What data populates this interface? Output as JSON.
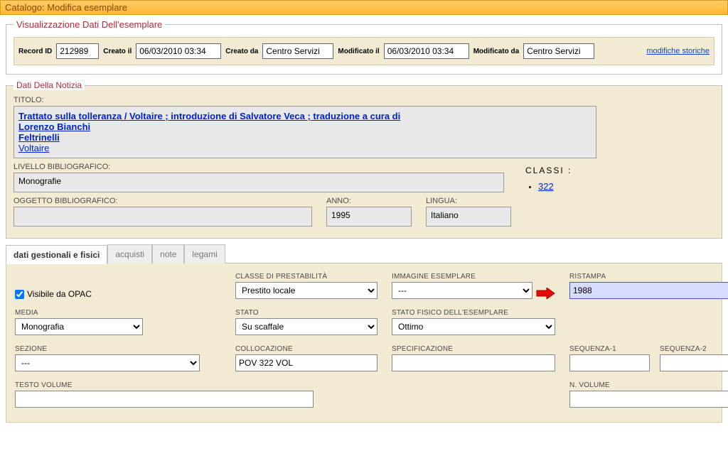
{
  "title": "Catalogo: Modifica esemplare",
  "sections": {
    "main_legend": "Visualizzazione Dati Dell'esemplare",
    "notizia_legend": "Dati Della Notizia"
  },
  "meta": {
    "record_id_label": "Record ID",
    "record_id": "212989",
    "created_label": "Creato il",
    "created": "06/03/2010 03:34",
    "created_by_label": "Creato da",
    "created_by": "Centro Servizi",
    "modified_label": "Modificato il",
    "modified": "06/03/2010 03:34",
    "modified_by_label": "Modificato da",
    "modified_by": "Centro Servizi",
    "hist_link": "modifiche storiche"
  },
  "notizia": {
    "titolo_label": "TITOLO:",
    "titolo_line1": "Trattato sulla tolleranza / Voltaire ; introduzione di Salvatore Veca ; traduzione a cura di",
    "titolo_line2": "Lorenzo Bianchi",
    "publisher": "Feltrinelli",
    "author": "Voltaire",
    "livello_label": "LIVELLO BIBLIOGRAFICO:",
    "livello": "Monografie",
    "oggetto_label": "OGGETTO BIBLIOGRAFICO:",
    "oggetto": "",
    "anno_label": "ANNO:",
    "anno": "1995",
    "lingua_label": "LINGUA:",
    "lingua": "Italiano",
    "classi_label": "CLASSI :",
    "classi_item": "322"
  },
  "tabs": {
    "t1": "dati gestionali e fisici",
    "t2": "acquisti",
    "t3": "note",
    "t4": "legami"
  },
  "form": {
    "visible_opac": "Visibile da OPAC",
    "classe_prest_label": "CLASSE DI PRESTABILITÀ",
    "classe_prest": "Prestito locale",
    "img_label": "IMMAGINE ESEMPLARE",
    "img_value": "---",
    "ristampa_label": "RISTAMPA",
    "ristampa": "1988",
    "media_label": "MEDIA",
    "media": "Monografia",
    "stato_label": "STATO",
    "stato": "Su scaffale",
    "stato_fisico_label": "STATO FISICO DELL'ESEMPLARE",
    "stato_fisico": "Ottimo",
    "sezione_label": "SEZIONE",
    "sezione": "---",
    "collocazione_label": "COLLOCAZIONE",
    "collocazione": "POV 322 VOL",
    "specificazione_label": "SPECIFICAZIONE",
    "specificazione": "",
    "seq1_label": "SEQUENZA-1",
    "seq1": "",
    "seq2_label": "SEQUENZA-2",
    "seq2": "",
    "testo_vol_label": "TESTO VOLUME",
    "testo_vol": "",
    "n_vol_label": "N. VOLUME",
    "n_vol": ""
  }
}
